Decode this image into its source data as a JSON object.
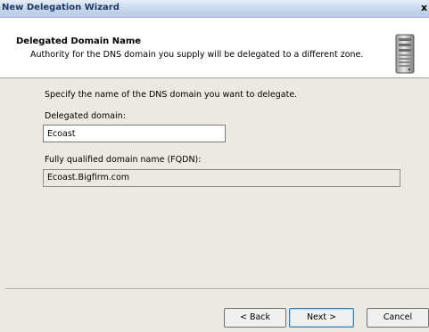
{
  "window": {
    "title": "New Delegation Wizard",
    "close_glyph": "x"
  },
  "header": {
    "title": "Delegated Domain Name",
    "subtitle": "Authority for the DNS domain you supply will be delegated to a different zone.",
    "icon": "server-icon"
  },
  "content": {
    "intro": "Specify the name of the DNS domain you want to delegate.",
    "delegated_label": "Delegated domain:",
    "delegated_value": "Ecoast",
    "fqdn_label": "Fully qualified domain name (FQDN):",
    "fqdn_value": "Ecoast.Bigfirm.com"
  },
  "buttons": {
    "back": "< Back",
    "next": "Next >",
    "cancel": "Cancel"
  },
  "colors": {
    "titlebar": "#c6d6ec",
    "dialog_bg": "#ece9e2",
    "title_text": "#1e3967"
  }
}
